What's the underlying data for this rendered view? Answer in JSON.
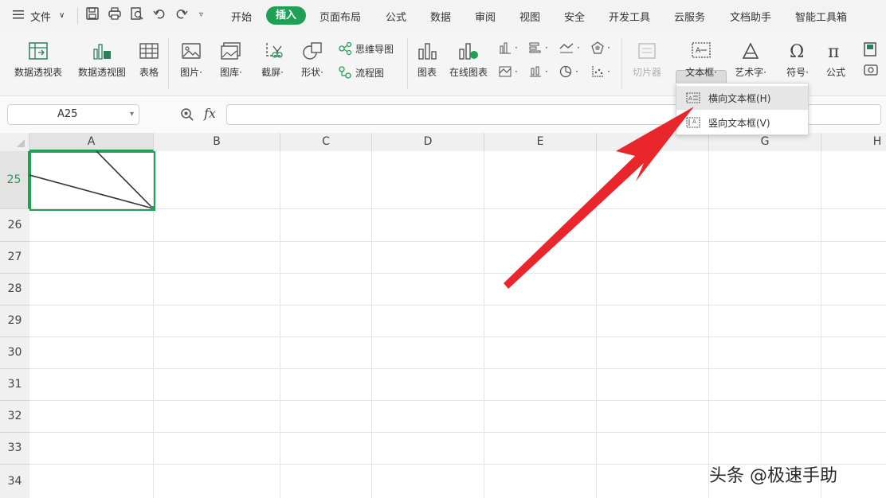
{
  "menubar": {
    "file_menu": "文件",
    "tabs": [
      "开始",
      "插入",
      "页面布局",
      "公式",
      "数据",
      "审阅",
      "视图",
      "安全",
      "开发工具",
      "云服务",
      "文档助手",
      "智能工具箱"
    ],
    "active_tab": "插入"
  },
  "ribbon": {
    "pivot_table": "数据透视表",
    "pivot_chart": "数据透视图",
    "table": "表格",
    "picture": "图片",
    "gallery": "图库",
    "screenshot": "截屏",
    "shape": "形状",
    "mindmap": "思维导图",
    "flowchart": "流程图",
    "chart": "图表",
    "online_chart": "在线图表",
    "slicer": "切片器",
    "textbox": "文本框",
    "wordart": "艺术字",
    "symbol": "符号",
    "formula": "公式",
    "dropdown_marker": "·"
  },
  "textbox_menu": {
    "items": [
      "横向文本框(H)",
      "竖向文本框(V)"
    ]
  },
  "formula_bar": {
    "cell_reference": "A25",
    "fx_label": "fx",
    "content": ""
  },
  "sheet": {
    "columns": [
      "A",
      "B",
      "C",
      "D",
      "E",
      "F",
      "G",
      "H"
    ],
    "rows": [
      "25",
      "26",
      "27",
      "28",
      "29",
      "30",
      "31",
      "32",
      "33",
      "34"
    ],
    "selected_cell": "A25"
  },
  "colors": {
    "accent": "#1fa055",
    "arrow": "#e8262b"
  },
  "watermark": "头条 @极速手助"
}
